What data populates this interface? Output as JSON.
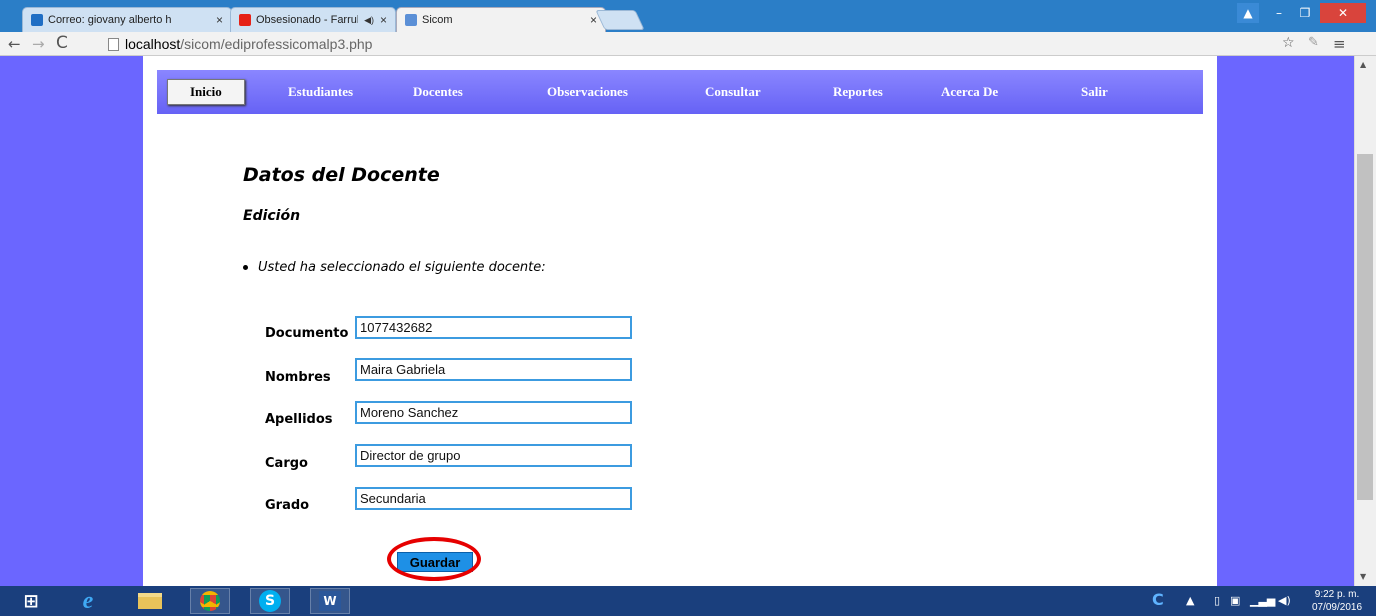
{
  "browser": {
    "tabs": [
      {
        "title": "Correo: giovany alberto h",
        "favicon_color": "#1f6ec4",
        "state": "inactive"
      },
      {
        "title": "Obsesionado - Farruko",
        "favicon_color": "#e62117",
        "state": "inactive"
      },
      {
        "title": "Sicom",
        "favicon_color": "#5b8fd6",
        "state": "active"
      }
    ],
    "close_glyph": "×",
    "url_host": "localhost",
    "url_path": "/sicom/ediprofessicomalp3.php"
  },
  "nav": {
    "items": [
      "Inicio",
      "Estudiantes",
      "Docentes",
      "Observaciones",
      "Consultar",
      "Reportes",
      "Acerca De",
      "Salir"
    ]
  },
  "content": {
    "title": "Datos del Docente",
    "subtitle": "Edición",
    "bullet": "Usted ha seleccionado el siguiente docente:"
  },
  "form": {
    "fields": [
      {
        "label": "Documento",
        "value": "1077432682"
      },
      {
        "label": "Nombres",
        "value": "Maira Gabriela"
      },
      {
        "label": "Apellidos",
        "value": "Moreno Sanchez"
      },
      {
        "label": "Cargo",
        "value": "Director de grupo"
      },
      {
        "label": "Grado",
        "value": "Secundaria"
      }
    ],
    "save_label": "Guardar"
  },
  "taskbar": {
    "time": "9:22 p. m.",
    "date": "07/09/2016"
  },
  "colors": {
    "page_background": "#6b66ff",
    "navbar": "#7470fb",
    "input_border": "#3c9be0",
    "save_button": "#1e90e6",
    "highlight_circle": "#e60000",
    "taskbar": "#1a3f7d"
  }
}
